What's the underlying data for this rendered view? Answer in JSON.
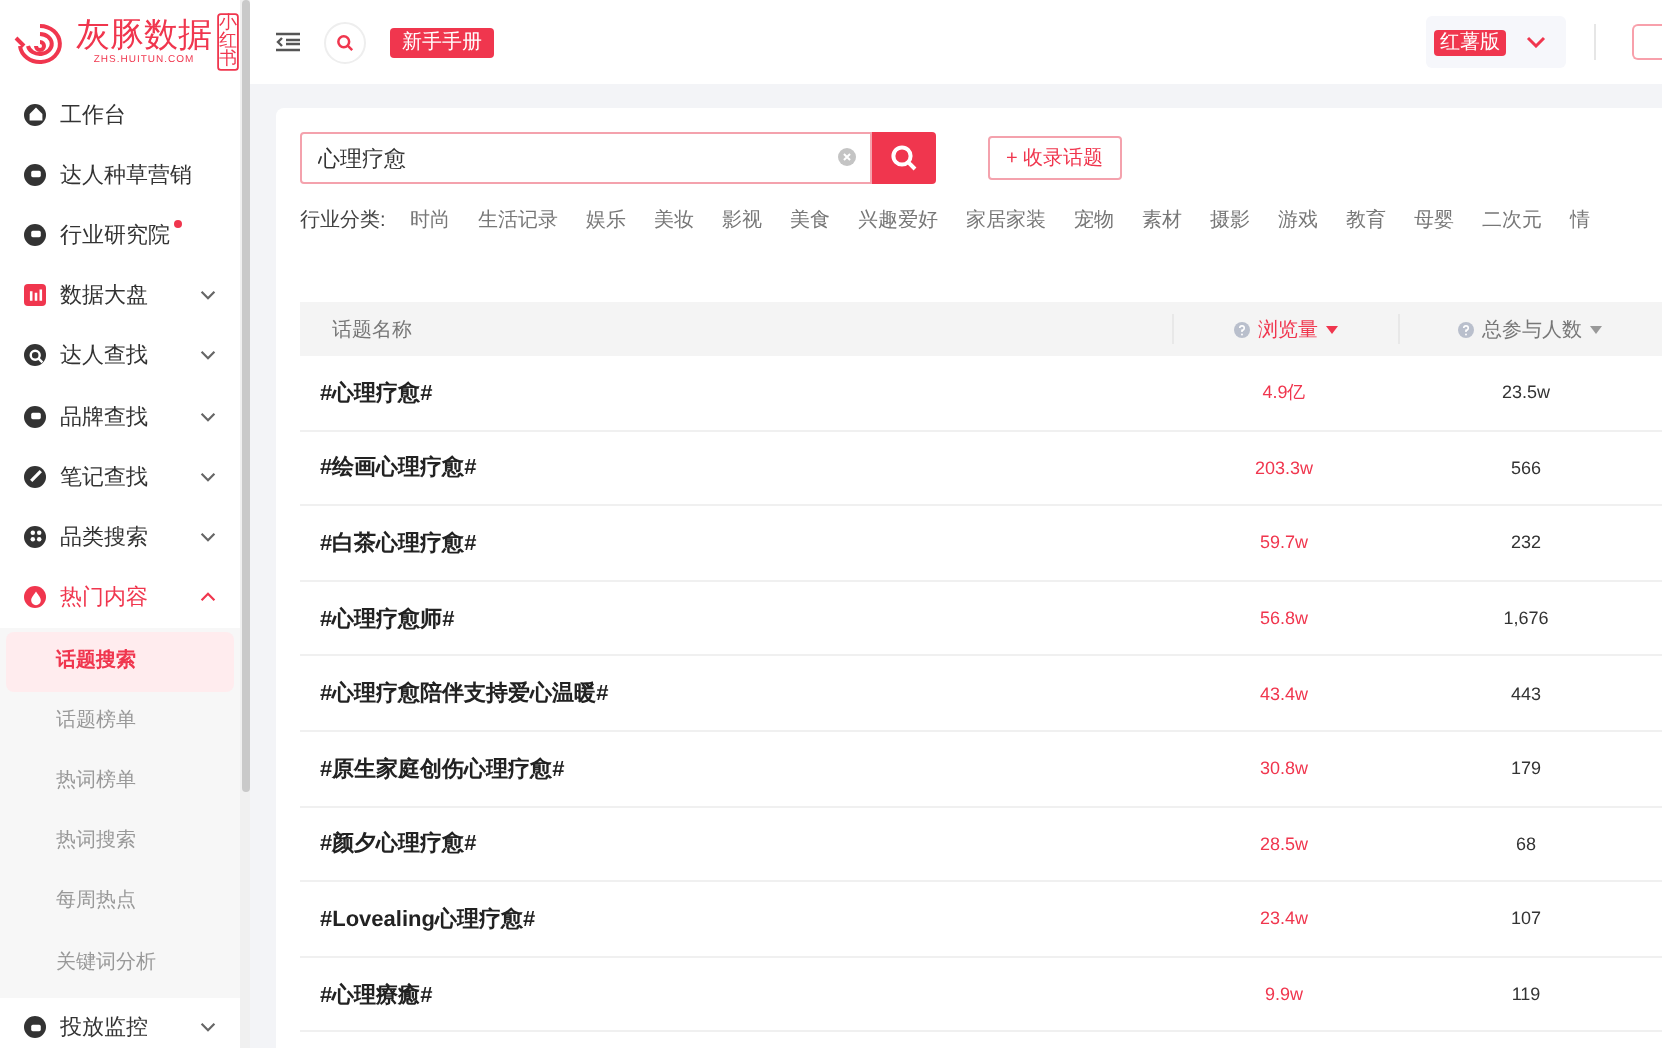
{
  "logo": {
    "name": "灰豚数据",
    "url": "ZHS.HUITUN.COM",
    "badge": "小红书"
  },
  "sidebar": {
    "items": [
      {
        "label": "工作台",
        "selected": false
      },
      {
        "label": "达人种草营销",
        "selected": false
      },
      {
        "label": "行业研究院",
        "dot": true,
        "selected": false
      },
      {
        "label": "数据大盘",
        "expanded": false,
        "selected": false
      },
      {
        "label": "达人查找",
        "expanded": false,
        "selected": false
      },
      {
        "label": "品牌查找",
        "expanded": false,
        "selected": false
      },
      {
        "label": "笔记查找",
        "expanded": false,
        "selected": false
      },
      {
        "label": "品类搜索",
        "expanded": false,
        "selected": false
      },
      {
        "label": "热门内容",
        "expanded": true,
        "selected": true,
        "children": [
          {
            "label": "话题搜索",
            "selected": true
          },
          {
            "label": "话题榜单",
            "selected": false
          },
          {
            "label": "热词榜单",
            "selected": false
          },
          {
            "label": "热词搜索",
            "selected": false
          },
          {
            "label": "每周热点",
            "selected": false
          },
          {
            "label": "关键词分析",
            "selected": false
          }
        ]
      },
      {
        "label": "投放监控",
        "expanded": false,
        "selected": false
      }
    ]
  },
  "topbar": {
    "guide_button": "新手手册",
    "version": "红薯版"
  },
  "search": {
    "value": "心理疗愈",
    "collect_button": "+ 收录话题"
  },
  "categories": {
    "label": "行业分类:",
    "items": [
      "时尚",
      "生活记录",
      "娱乐",
      "美妆",
      "影视",
      "美食",
      "兴趣爱好",
      "家居家装",
      "宠物",
      "素材",
      "摄影",
      "游戏",
      "教育",
      "母婴",
      "二次元",
      "情"
    ]
  },
  "table": {
    "columns": [
      {
        "label": "话题名称"
      },
      {
        "label": "浏览量",
        "sorted": true
      },
      {
        "label": "总参与人数",
        "sorted": false
      }
    ],
    "rows": [
      {
        "topic": "#心理疗愈#",
        "views": "4.9亿",
        "participants": "23.5w"
      },
      {
        "topic": "#绘画心理疗愈#",
        "views": "203.3w",
        "participants": "566"
      },
      {
        "topic": "#白茶心理疗愈#",
        "views": "59.7w",
        "participants": "232"
      },
      {
        "topic": "#心理疗愈师#",
        "views": "56.8w",
        "participants": "1,676"
      },
      {
        "topic": "#心理疗愈陪伴支持爱心温暖#",
        "views": "43.4w",
        "participants": "443"
      },
      {
        "topic": "#原生家庭创伤心理疗愈#",
        "views": "30.8w",
        "participants": "179"
      },
      {
        "topic": "#颜夕心理疗愈#",
        "views": "28.5w",
        "participants": "68"
      },
      {
        "topic": "#Lovealing心理疗愈#",
        "views": "23.4w",
        "participants": "107"
      },
      {
        "topic": "#心理療癒#",
        "views": "9.9w",
        "participants": "119"
      }
    ]
  }
}
